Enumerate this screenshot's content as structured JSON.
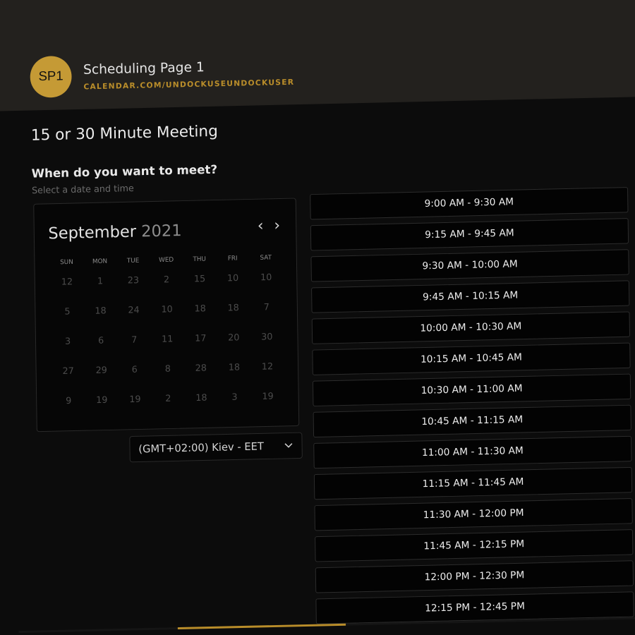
{
  "header": {
    "avatar_initials": "SP1",
    "page_name": "Scheduling Page 1",
    "page_url": "CALENDAR.COM/UNDOCKUSEUNDOCKUSER"
  },
  "meeting": {
    "title": "15 or 30 Minute Meeting",
    "question": "When do you want to meet?",
    "hint": "Select a date and time"
  },
  "calendar": {
    "month": "September",
    "year": "2021",
    "prev_icon": "chevron-left-icon",
    "next_icon": "chevron-right-icon",
    "weekdays": [
      "SUN",
      "MON",
      "TUE",
      "WED",
      "THU",
      "FRI",
      "SAT"
    ],
    "weeks": [
      [
        "12",
        "1",
        "23",
        "2",
        "15",
        "10",
        "10"
      ],
      [
        "5",
        "18",
        "24",
        "10",
        "18",
        "18",
        "7"
      ],
      [
        "3",
        "6",
        "7",
        "11",
        "17",
        "20",
        "30"
      ],
      [
        "27",
        "29",
        "6",
        "8",
        "28",
        "18",
        "12"
      ],
      [
        "9",
        "19",
        "19",
        "2",
        "18",
        "3",
        "19"
      ]
    ]
  },
  "timezone": {
    "value": "(GMT+02:00) Kiev - EET",
    "icon": "chevron-down-icon"
  },
  "time_slots": [
    "9:00 AM - 9:30 AM",
    "9:15 AM - 9:45 AM",
    "9:30 AM - 10:00 AM",
    "9:45 AM - 10:15 AM",
    "10:00 AM - 10:30 AM",
    "10:15 AM - 10:45 AM",
    "10:30 AM - 11:00 AM",
    "10:45 AM - 11:15 AM",
    "11:00 AM - 11:30 AM",
    "11:15 AM - 11:45 AM",
    "11:30 AM - 12:00 PM",
    "11:45 AM - 12:15 PM",
    "12:00 PM - 12:30 PM",
    "12:15 PM - 12:45 PM"
  ],
  "progress": {
    "fraction": 0.27
  },
  "colors": {
    "accent": "#c59a35",
    "header_background": "#23211e",
    "page_background": "#0c0c0c"
  }
}
